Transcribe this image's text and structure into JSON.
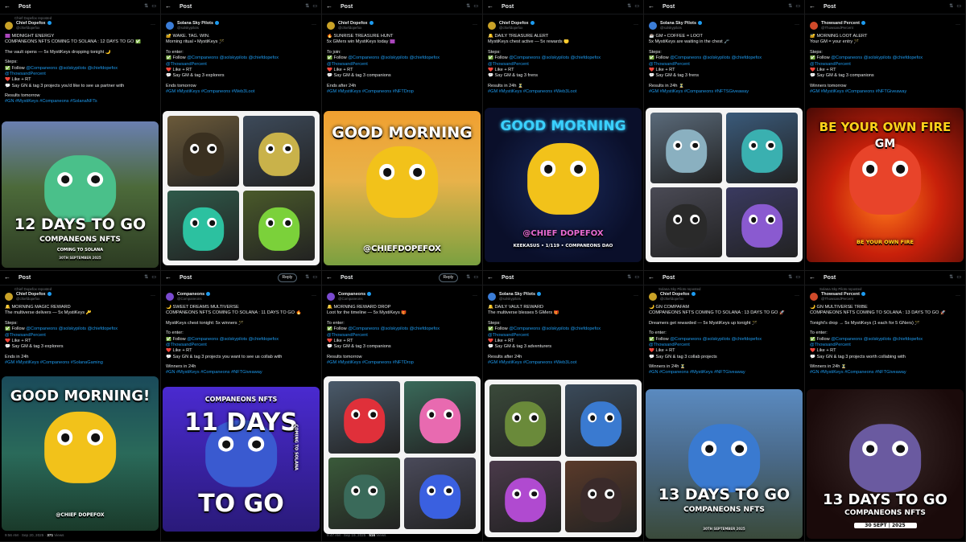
{
  "colors": {
    "link": "#1d9bf0",
    "verified": "#1d9bf0",
    "muted": "#71767b",
    "bg": "#000000"
  },
  "panels": [
    {
      "title": "Post",
      "repost": "Chief Dopefox reposted",
      "author": "Chief Dopefox",
      "handle": "@chiefdopefox",
      "avatar_color": "#c9a227",
      "lines": [
        "🟪 MIDNIGHT ENERGY",
        "COMPANEONS NFTS COMING TO SOLANA : 12 DAYS TO GO ✅",
        "",
        "The vault opens — 5x MystiKeys dropping tonight 🌙",
        "",
        "Steps:",
        "✅ Follow @Companeons @solskypilots @chiefdopefox",
        "@ThowsandPercent",
        "❤️ Like + RT",
        "💬 Say GN & tag 3 projects you'd like to see us partner with",
        "",
        "Results tomorrow",
        "#GN #MystiKeys #Companeons #SolanaNFTs"
      ],
      "media": {
        "type": "banner",
        "big": "12 DAYS TO GO",
        "sub": "COMPANEONS NFTS",
        "sub2": "COMING TO SOLANA",
        "small": "30TH SEPTEMBER 2025",
        "bg": "linear-gradient(180deg,#6a7fb0 0%,#4c6a3a 45%,#2c3b22 100%)"
      }
    },
    {
      "title": "Post",
      "repost": "",
      "author": "Solana Sky Pilots",
      "handle": "@solskypilots",
      "avatar_color": "#3b7dd8",
      "lines": [
        "🔐 WAKE. TAG. WIN.",
        "Morning ritual • MystiKeys 🪄",
        "",
        "To enter:",
        "✅ Follow @Companeons @solskypilots @chiefdopefox",
        "@ThowsandPercent",
        "❤️ Like + RT",
        "💬 Say GM & tag 3 explorers",
        "",
        "Ends tomorrow",
        "#GM #MystiKeys #Companeons #Web3Loot"
      ],
      "media": {
        "type": "quad",
        "colors": [
          "#6b5a3a",
          "#3d4a5a",
          "#2f5a4a",
          "#4a5a2a"
        ],
        "critter": [
          "#3a3020",
          "#c9b24a",
          "#2cc1a0",
          "#7bd13a"
        ]
      }
    },
    {
      "title": "Post",
      "repost": "",
      "author": "Chief Dopefox",
      "handle": "@chiefdopefox",
      "avatar_color": "#c9a227",
      "lines": [
        "🔥 SUNRISE TREASURE HUNT",
        "5x GMers win MystiKeys today 🟪",
        "",
        "To join:",
        "✅ Follow @Companeons @solskypilots @chiefdopefox",
        "@ThowsandPercent",
        "❤️ Like + RT",
        "💬 Say GM & tag 3 companions",
        "",
        "Ends after 24h",
        "#GM #MystiKeys #Companeons #NFTDrop"
      ],
      "media": {
        "type": "gm",
        "big": "GOOD MORNING",
        "tag": "@CHIEFDOPEFOX",
        "bg": "linear-gradient(180deg,#f0a030 0%,#e8b24a 45%,#7aa040 100%)",
        "critter": "#f2c21a"
      }
    },
    {
      "title": "Post",
      "repost": "",
      "author": "Chief Dopefox",
      "handle": "@chiefdopefox",
      "avatar_color": "#c9a227",
      "lines": [
        "🔔 DAILY TREASURE ALERT",
        "MystiKeys chest active — 5x rewards 🟡",
        "",
        "Steps:",
        "✅ Follow @Companeons @solskypilots @chiefdopefox",
        "@ThowsandPercent",
        "❤️ Like + RT",
        "💬 Say GM & tag 3 frens",
        "",
        "Results in 24h ⏳",
        "#GM #MystiKeys #Companeons #Web3Loot"
      ],
      "media": {
        "type": "neon",
        "big": "GOOD MORNING",
        "tag": "@CHIEF DOPEFOX",
        "small": "KEEKASUS • 1/119 • COMPANEONS DAO",
        "bg": "radial-gradient(circle at 50% 50%,#1a2a5a 0%,#0a0f2a 70%)",
        "critter": "#f2c21a"
      }
    },
    {
      "title": "Post",
      "repost": "",
      "author": "Solana Sky Pilots",
      "handle": "@solskypilots",
      "avatar_color": "#3b7dd8",
      "lines": [
        "☕ GM • COFFEE = LOOT",
        "5x MystiKeys are waiting in the chest 🗝️",
        "",
        "Steps:",
        "✅ Follow @Companeons @solskypilots @chiefdopefox",
        "@ThowsandPercent",
        "❤️ Like + RT",
        "💬 Say GM & tag 3 frens",
        "",
        "Results in 24h ⏳",
        "#GM #MystiKeys #Companeons #NFTSGiveaway"
      ],
      "media": {
        "type": "quad",
        "colors": [
          "#5a6a7a",
          "#3a5a7a",
          "#4a4a55",
          "#3a3a60"
        ],
        "critter": [
          "#8ab0c0",
          "#3ab0b0",
          "#2a2a2a",
          "#8a5ad0"
        ]
      }
    },
    {
      "title": "Post",
      "repost": "",
      "author": "Thowsand Percent",
      "handle": "@ThowsandPercent",
      "avatar_color": "#d04a2a",
      "lines": [
        "🔐 MORNING LOOT ALERT",
        "Your GM = your entry 🪄",
        "",
        "Steps:",
        "✅ Follow @Companeons @solskypilots @chiefdopefox",
        "@ThowsandPercent",
        "❤️ Like + RT",
        "💬 Say GM & tag 3 companions",
        "",
        "Winners tomorrow",
        "#GM #MystiKeys #Companeons #NFTGiveaway"
      ],
      "media": {
        "type": "fire",
        "big": "BE YOUR OWN FIRE",
        "sub": "GM",
        "small": "BE YOUR OWN FIRE",
        "bg": "radial-gradient(circle at 50% 60%,#ff7a1a 0%,#c8200a 45%,#4a0a05 100%)",
        "critter": "#e8442a"
      }
    },
    {
      "title": "Post",
      "repost": "Chief Dopefox reposted",
      "author": "Chief Dopefox",
      "handle": "@chiefdopefox",
      "avatar_color": "#c9a227",
      "lines": [
        "🔔 MORNING MAGIC REWARD",
        "The multiverse delivers — 5x MystiKeys 🔑",
        "",
        "Steps:",
        "✅ Follow @Companeons @solskypilots @chiefdopefox",
        "@ThowsandPercent",
        "❤️ Like + RT",
        "💬 Say GM & tag 3 explorers",
        "",
        "Ends in 24h",
        "#GM #MystiKeys #Companeons #SolanaGaming"
      ],
      "media": {
        "type": "gm2",
        "big": "GOOD MORNING!",
        "tag": "@CHIEF DOPEFOX",
        "bg": "linear-gradient(180deg,#1a4a5a 0%,#2a6a5a 50%,#1a3a2a 100%)",
        "critter": "#f2c21a"
      },
      "footer": {
        "time": "9:56 AM · Sep 20, 2025 · ",
        "views": "371",
        "views_label": " Views"
      }
    },
    {
      "title": "Post",
      "reply": "Reply",
      "repost": "",
      "author": "Companeons",
      "handle": "@Companeons",
      "avatar_color": "#7a4ad0",
      "lines": [
        "🌙 SWEET DREAMS MULTIVERSE",
        "COMPANEONS NFTS COMING TO SOLANA : 11 DAYS TO GO 🔥",
        "",
        "MystiKeys chest tonight: 5x winners 🪄",
        "",
        "To enter:",
        "✅ Follow @Companeons @solskypilots @chiefdopefox",
        "@ThowsandPercent",
        "❤️ Like + RT",
        "💬 Say GN & tag 3 projects you want to see us collab with",
        "",
        "Winners in 24h",
        "#GN #MystiKeys #Companeons #NFTGiveaway"
      ],
      "media": {
        "type": "days11",
        "top": "COMPANEONS NFTS",
        "big": "11 DAYS",
        "big2": "TO GO",
        "side": "COMING TO SOLANA",
        "bg": "linear-gradient(180deg,#4a2ad0 0%,#2a1a7a 100%)",
        "critter": "#3a5ad0"
      }
    },
    {
      "title": "Post",
      "reply": "Reply",
      "repost": "",
      "author": "Companeons",
      "handle": "@Companeons",
      "avatar_color": "#7a4ad0",
      "lines": [
        "🔔 MORNING REWARD DROP",
        "Loot for the timeline — 5x MystiKeys 🎁",
        "",
        "To enter:",
        "✅ Follow @Companeons @solskypilots @chiefdopefox",
        "@ThowsandPercent",
        "❤️ Like + RT",
        "💬 Say GM & tag 3 companions",
        "",
        "Results tomorrow",
        "#GM #MystiKeys #Companeons #NFTDrop"
      ],
      "media": {
        "type": "quad",
        "colors": [
          "#4a5a6a",
          "#3a6a5a",
          "#3a5a3a",
          "#4a4a5a"
        ],
        "critter": [
          "#e0303a",
          "#e86ab0",
          "#3a6a5a",
          "#3a60e0"
        ]
      },
      "footer": {
        "time": "9:47 AM · Sep 19, 2025 · ",
        "views": "516",
        "views_label": " Views"
      }
    },
    {
      "title": "Post",
      "repost": "",
      "author": "Solana Sky Pilots",
      "handle": "@solskypilots",
      "avatar_color": "#3b7dd8",
      "lines": [
        "🔔 DAILY VAULT REWARD",
        "The multiverse blesses 5 GMers 🎁",
        "",
        "Steps:",
        "✅ Follow @Companeons @solskypilots @chiefdopefox",
        "@ThowsandPercent",
        "❤️ Like + RT",
        "💬 Say GM & tag 3 adventurers",
        "",
        "Results after 24h",
        "#GM #MystiKeys #Companeons #Web3Loot"
      ],
      "media": {
        "type": "quad",
        "colors": [
          "#3a4a3a",
          "#3a4a5a",
          "#4a3a4a",
          "#5a3a2a"
        ],
        "critter": [
          "#6a8a3a",
          "#3a7ad0",
          "#b04ad0",
          "#3a2a2a"
        ]
      }
    },
    {
      "title": "Post",
      "repost": "Solana Sky Pilots reposted",
      "author": "Chief Dopefox",
      "handle": "@chiefdopefox",
      "avatar_color": "#c9a227",
      "lines": [
        "🌙 GN COMPAFAM",
        "COMPANEONS NFTS COMING TO SOLANA : 13 DAYS TO GO 🚀",
        "",
        "Dreamers get rewarded — 5x MystiKeys up tonight 🪄",
        "",
        "To enter:",
        "✅ Follow @Companeons @solskypilots @chiefdopefox",
        "@ThowsandPercent",
        "❤️ Like + RT",
        "💬 Say GN & tag 3 collab projects",
        "",
        "Winners in 24h ⏳",
        "#GN #Companeons #MystiKeys #NFTGiveaway"
      ],
      "media": {
        "type": "banner",
        "big": "13 DAYS TO GO",
        "sub": "COMPANEONS NFTS",
        "sub2": "",
        "small": "30TH SEPTEMBER 2025",
        "bg": "linear-gradient(180deg,#5a8ac0 0%,#4a6a8a 45%,#3a4a3a 100%)",
        "critter": "#3a7ad0"
      }
    },
    {
      "title": "Post",
      "repost": "Solana Sky Pilots reposted",
      "author": "Thowsand Percent",
      "handle": "@ThowsandPercent",
      "avatar_color": "#d04a2a",
      "lines": [
        "🌙 GN MULTIVERSE TRIBE",
        "COMPANEONS NFTS COMING TO SOLANA : 13 DAYS TO GO 🚀",
        "",
        "Tonight's drop → 5x MystiKeys (1 each for 5 GNers) 🪄",
        "",
        "To enter:",
        "✅ Follow @Companeons @solskypilots @chiefdopefox",
        "@ThowsandPercent",
        "❤️ Like + RT",
        "💬 Say GN & tag 3 projects worth collabing with",
        "",
        "Winners in 24h ⏳",
        "#GN #MystiKeys #Companeons #NFTGiveaway"
      ],
      "media": {
        "type": "days13",
        "big": "13 DAYS TO GO",
        "sub": "COMPANEONS NFTS",
        "small": "30 SEPT | 2025",
        "bg": "radial-gradient(circle at 50% 40%,#3a2a2a 0%,#1a0a0a 70%)",
        "critter": "#6a5aa0"
      }
    }
  ]
}
